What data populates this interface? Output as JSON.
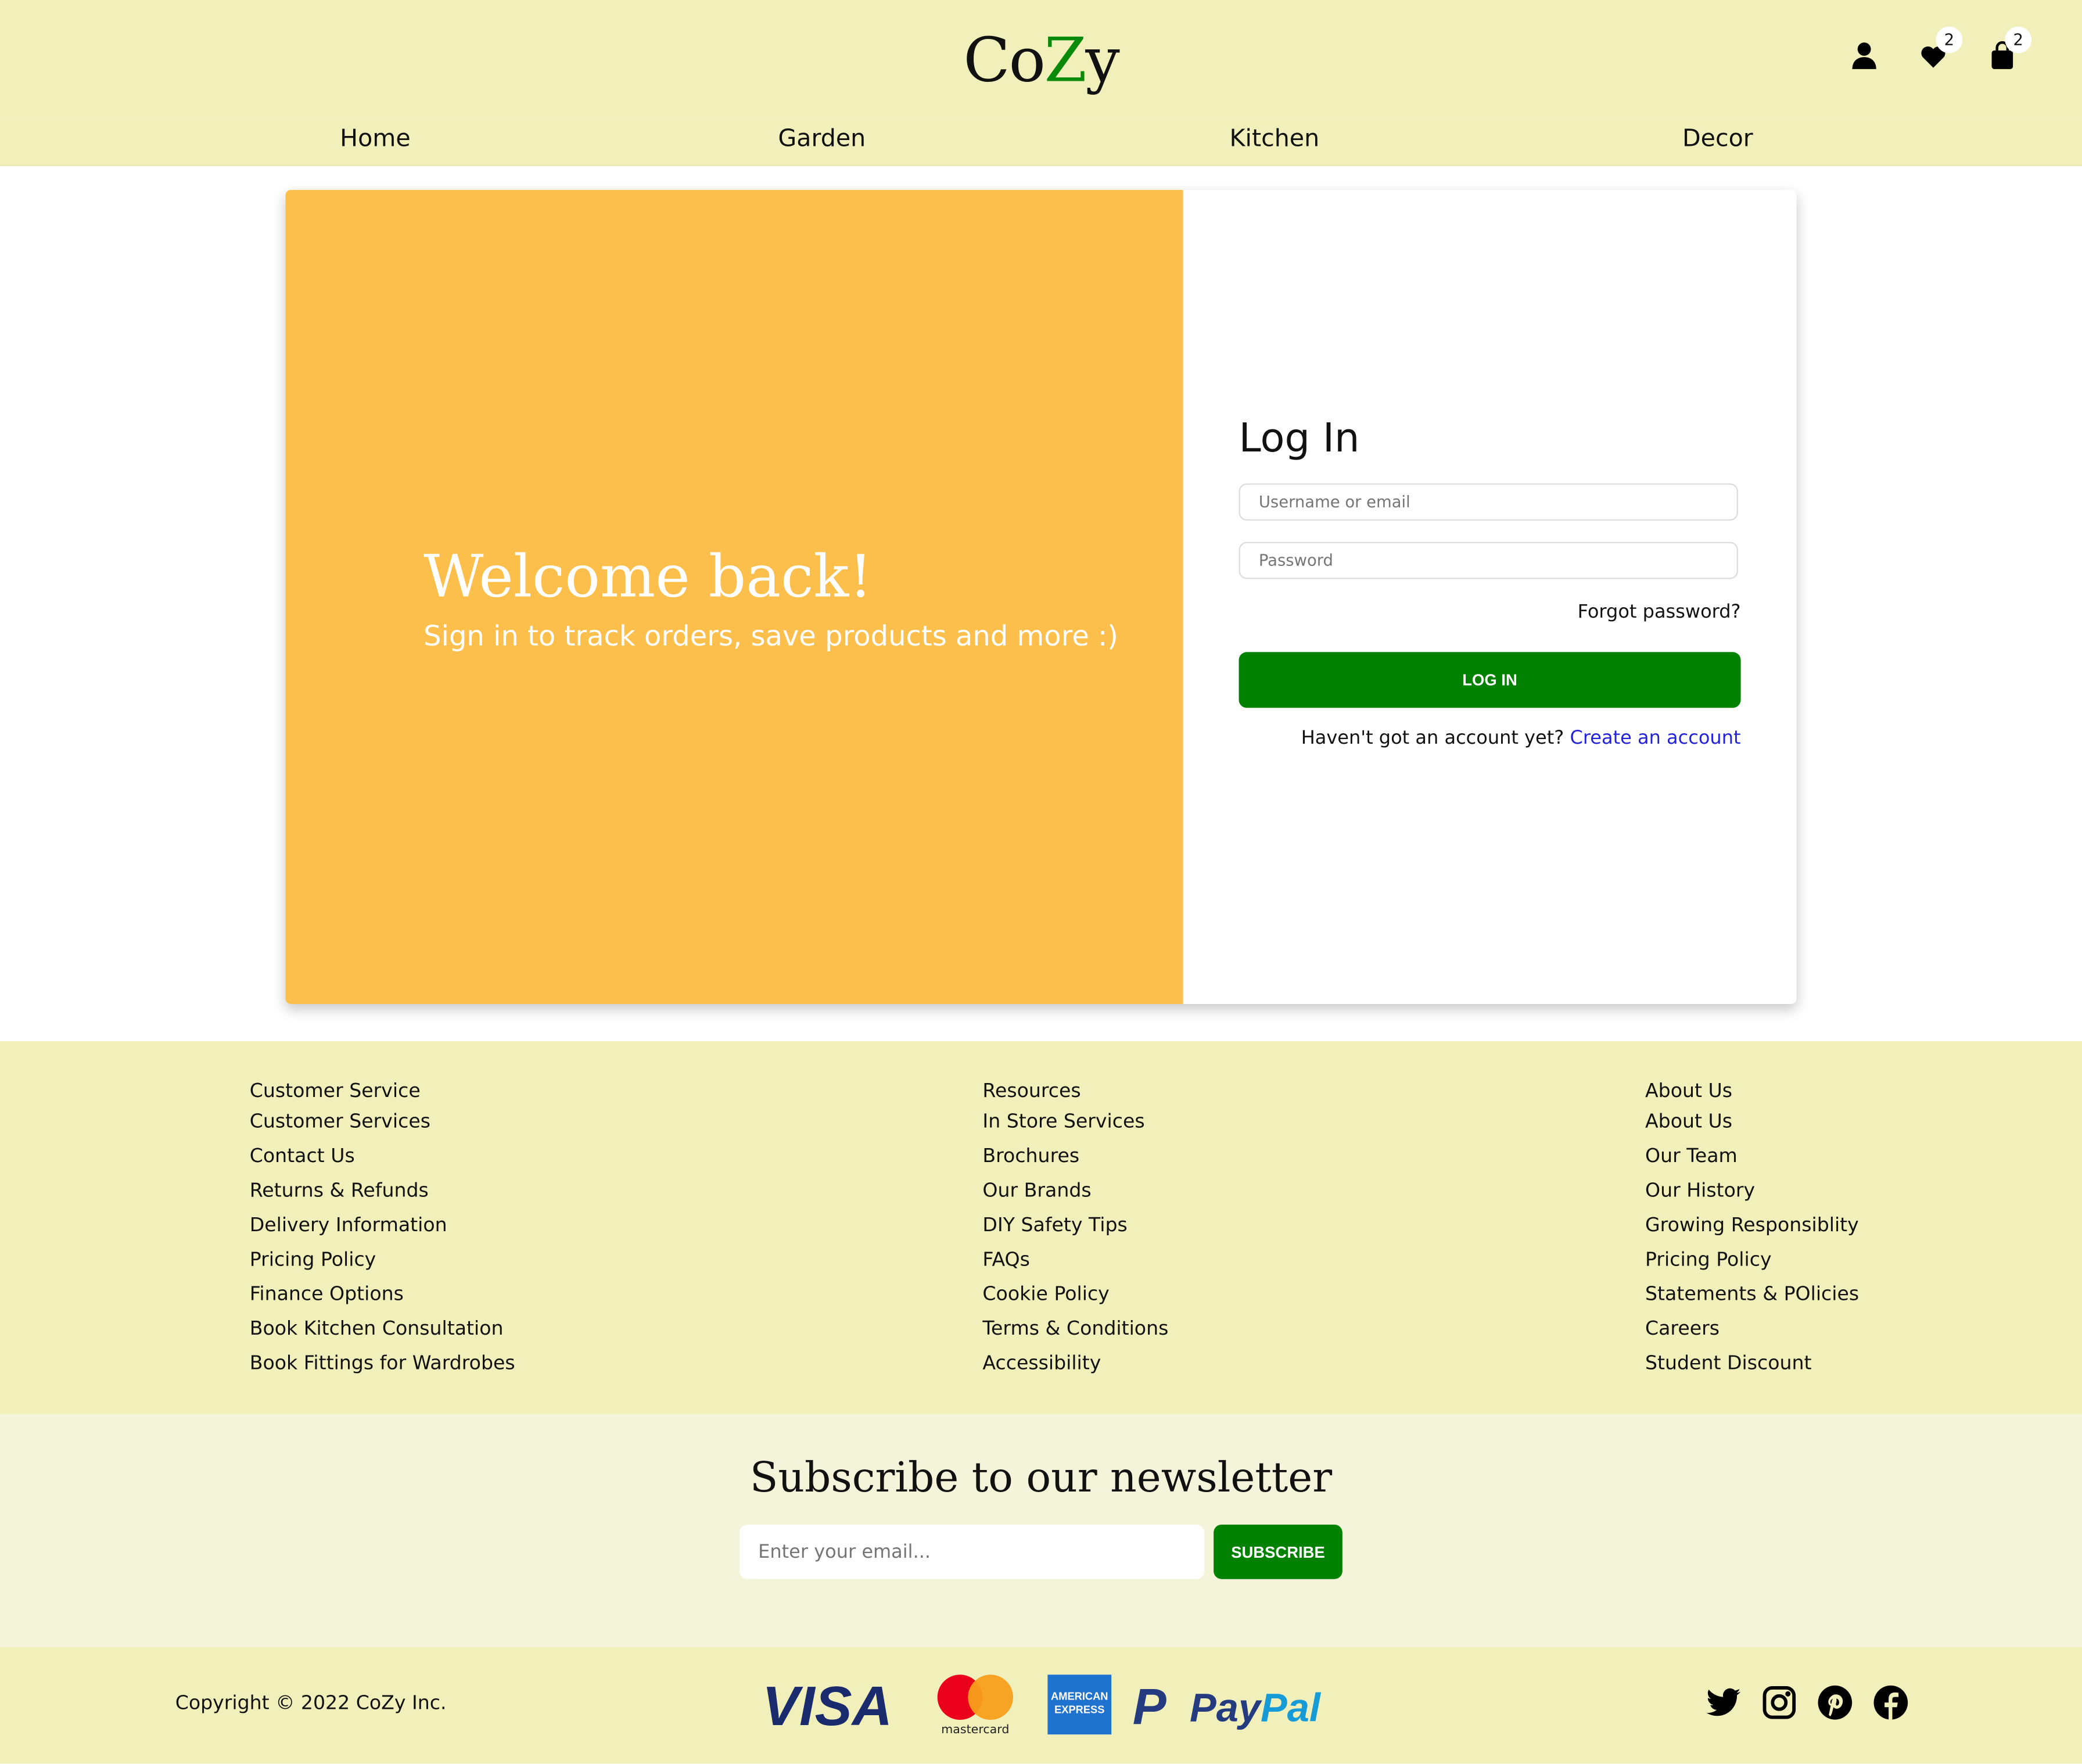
{
  "header": {
    "logo_prefix": "Co",
    "logo_z": "Z",
    "logo_suffix": "y",
    "wishlist_count": "2",
    "cart_count": "2"
  },
  "nav": [
    "Home",
    "Garden",
    "Kitchen",
    "Decor"
  ],
  "hero": {
    "title": "Welcome back!",
    "subtitle": "Sign in to track orders, save products and more :)"
  },
  "login": {
    "title": "Log In",
    "username_placeholder": "Username or email",
    "password_placeholder": "Password",
    "forgot": "Forgot password?",
    "button": "LOG IN",
    "signup_text": "Haven't got an account yet?",
    "signup_link": "Create an account"
  },
  "footer": {
    "columns": [
      {
        "heading": "Customer Service",
        "items": [
          "Customer Services",
          "Contact Us",
          "Returns & Refunds",
          "Delivery Information",
          "Pricing Policy",
          "Finance Options",
          "Book Kitchen Consultation",
          "Book Fittings for Wardrobes"
        ]
      },
      {
        "heading": "Resources",
        "items": [
          "In Store Services",
          "Brochures",
          "Our Brands",
          "DIY Safety Tips",
          "FAQs",
          "Cookie Policy",
          "Terms & Conditions",
          "Accessibility"
        ]
      },
      {
        "heading": "About Us",
        "items": [
          "About Us",
          "Our Team",
          "Our History",
          "Growing Responsiblity",
          "Pricing Policy",
          "Statements & POlicies",
          "Careers",
          "Student Discount"
        ]
      }
    ]
  },
  "newsletter": {
    "title": "Subscribe to our newsletter",
    "placeholder": "Enter your email...",
    "button": "SUBSCRIBE"
  },
  "bottom": {
    "copyright": "Copyright © 2022 CoZy Inc.",
    "visa": "VISA",
    "mastercard": "mastercard",
    "amex_line1": "AMERICAN",
    "amex_line2": "EXPRESS",
    "paypal_pay": "Pay",
    "paypal_pal": "Pal"
  },
  "colors": {
    "header_bg": "#f1f0bb",
    "accent_green": "#008200",
    "hero_orange": "#fcbf4b",
    "link_blue": "#2222dd"
  }
}
